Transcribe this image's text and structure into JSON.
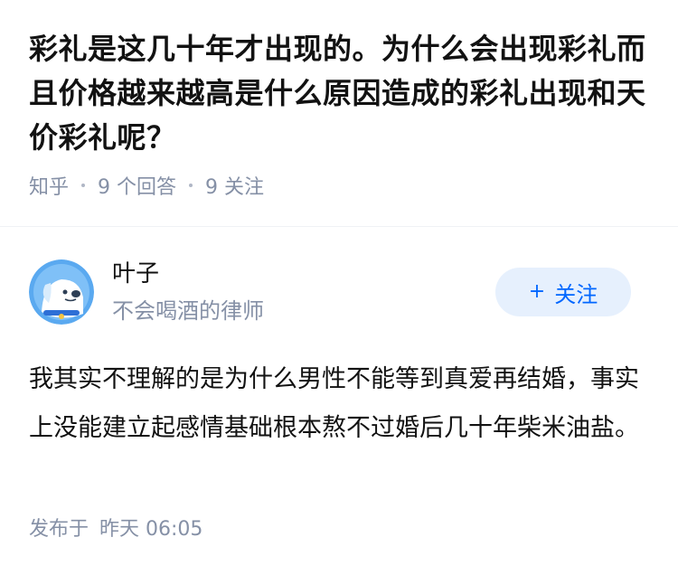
{
  "question": {
    "title": "彩礼是这几十年才出现的。为什么会出现彩礼而且价格越来越高是什么原因造成的彩礼出现和天价彩礼呢？",
    "source": "知乎",
    "answer_count": "9 个回答",
    "follower_count": "9 关注"
  },
  "answer": {
    "author": {
      "name": "叶子",
      "headline": "不会喝酒的律师",
      "avatar_icon": "dog-avatar-icon"
    },
    "follow_button": {
      "icon": "plus-icon",
      "icon_glyph": "+",
      "label": "关注"
    },
    "content": "我其实不理解的是为什么男性不能等到真爱再结婚，事实上没能建立起感情基础根本熬不过婚后几十年柴米油盐。",
    "published_label": "发布于",
    "published_time": "昨天 06:05"
  },
  "colors": {
    "accent": "#0066ff",
    "button_bg": "#e6f0fd",
    "meta_text": "#8590a6",
    "avatar_bg": "#5aa9f0"
  }
}
